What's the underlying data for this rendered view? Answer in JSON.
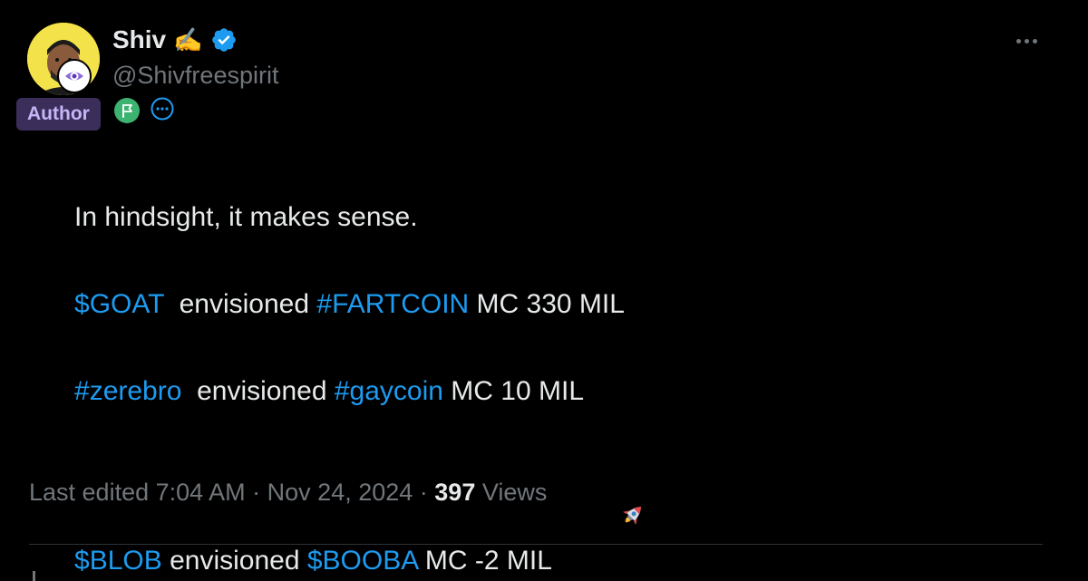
{
  "author": {
    "display_name": "Shiv",
    "name_emoji": "✍️",
    "handle": "@Shivfreespirit",
    "badge": "Author",
    "verified": true
  },
  "tweet": {
    "lines": [
      [
        {
          "text": "In hindsight, it makes sense.",
          "type": "text"
        }
      ],
      [],
      [
        {
          "text": "$GOAT",
          "type": "link"
        },
        {
          "text": "  envisioned ",
          "type": "text"
        },
        {
          "text": "#FARTCOIN",
          "type": "link"
        },
        {
          "text": " MC 330 MIL",
          "type": "text"
        }
      ],
      [],
      [
        {
          "text": "#zerebro",
          "type": "link"
        },
        {
          "text": "  envisioned ",
          "type": "text"
        },
        {
          "text": "#gaycoin",
          "type": "link"
        },
        {
          "text": " MC 10 MIL",
          "type": "text"
        }
      ],
      [],
      [
        {
          "text": "$BLOB",
          "type": "link"
        },
        {
          "text": " envisioned ",
          "type": "text"
        },
        {
          "text": "$BOOBA",
          "type": "link"
        },
        {
          "text": " MC -2 MIL",
          "type": "text"
        }
      ]
    ]
  },
  "meta": {
    "edited_label": "Last edited 7:04 AM · Nov 24, 2024 · ",
    "views_count": "397",
    "views_label": " Views"
  },
  "icons": {
    "verified": "verified-badge-icon",
    "flag": "flag-icon",
    "more_circle": "more-circle-icon",
    "more": "more-horizontal-icon",
    "rocket": "rocket-icon"
  },
  "colors": {
    "background": "#000000",
    "text": "#e7e9ea",
    "secondary": "#71767b",
    "link": "#1d9bf0",
    "author_badge_bg": "#3b2e5a",
    "author_badge_text": "#c7b6f7",
    "flag_bg": "#3cb371"
  }
}
